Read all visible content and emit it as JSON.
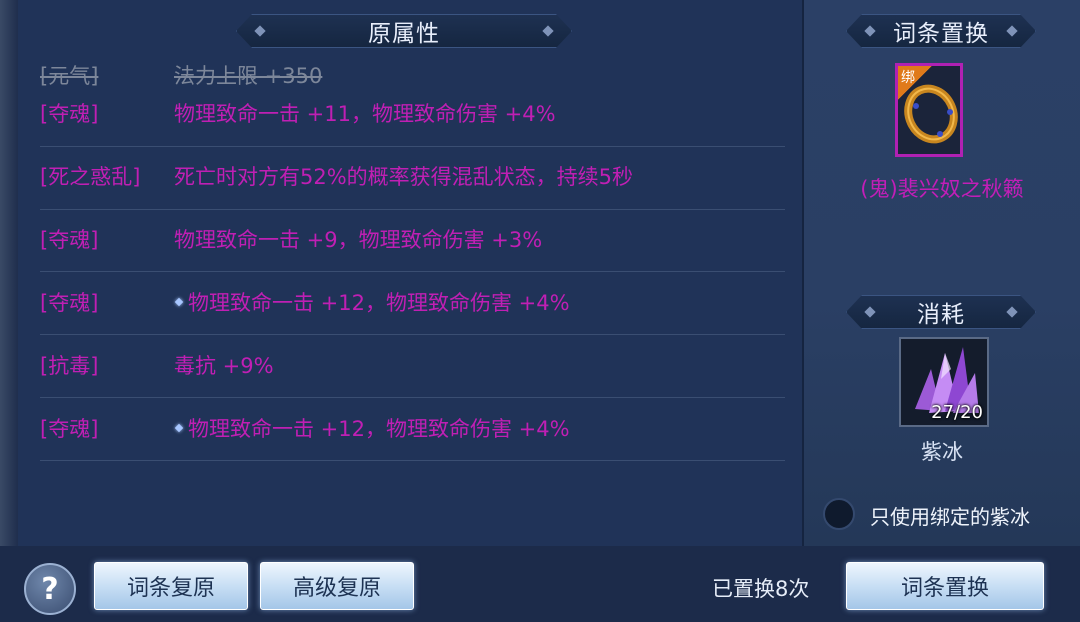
{
  "left_panel": {
    "title": "原属性",
    "attributes": [
      {
        "tag": "[元气]",
        "desc": "法力上限 +350",
        "struck": true
      },
      {
        "tag": "[夺魂]",
        "desc": "物理致命一击 +11，物理致命伤害 +4%"
      },
      {
        "tag": "[死之惑乱]",
        "desc": "死亡时对方有52%的概率获得混乱状态，持续5秒"
      },
      {
        "tag": "[夺魂]",
        "desc": "物理致命一击 +9，物理致命伤害 +3%"
      },
      {
        "tag": "[夺魂]",
        "desc": "物理致命一击 +12，物理致命伤害 +4%",
        "marked": true
      },
      {
        "tag": "[抗毒]",
        "desc": "毒抗 +9%"
      },
      {
        "tag": "[夺魂]",
        "desc": "物理致命一击 +12，物理致命伤害 +4%",
        "marked": true
      }
    ]
  },
  "right_panel": {
    "title": "词条置换",
    "item": {
      "bind_badge": "绑",
      "name": "(鬼)裴兴奴之秋籁",
      "icon": "gold-ring-icon",
      "border_color": "#b021b3"
    },
    "consume_title": "消耗",
    "consume": {
      "name": "紫冰",
      "count": "27/20",
      "icon": "purple-crystal-icon"
    },
    "option_label": "只使用绑定的紫冰"
  },
  "footer": {
    "help_label": "?",
    "restore_button": "词条复原",
    "advanced_restore_button": "高级复原",
    "status_text": "已置换8次",
    "replace_button": "词条置换"
  }
}
